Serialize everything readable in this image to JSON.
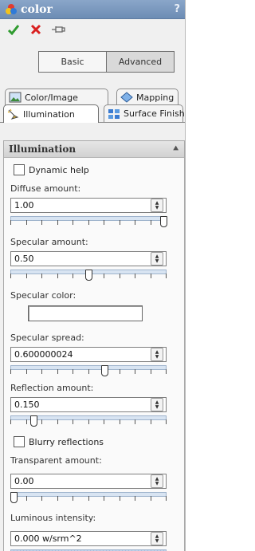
{
  "title": "color",
  "actions": {
    "ok_icon": "checkmark-icon",
    "cancel_icon": "x-icon",
    "pin_icon": "pushpin-icon"
  },
  "modes": [
    {
      "label": "Basic",
      "active": false
    },
    {
      "label": "Advanced",
      "active": true
    }
  ],
  "tabs": {
    "color_image": "Color/Image",
    "mapping": "Mapping",
    "illumination": "Illumination",
    "surface_finish": "Surface Finish"
  },
  "section": {
    "title": "Illumination",
    "dynamic_help": "Dynamic help",
    "diffuse": {
      "label": "Diffuse amount:",
      "value": "1.00",
      "level": 1.0
    },
    "specular": {
      "label": "Specular amount:",
      "value": "0.50",
      "level": 0.5
    },
    "specular_color": {
      "label": "Specular color:",
      "color": "#ffffff"
    },
    "spread": {
      "label": "Specular spread:",
      "value": "0.600000024",
      "level": 0.6
    },
    "reflection": {
      "label": "Reflection amount:",
      "value": "0.150",
      "level": 0.15
    },
    "blurry": "Blurry reflections",
    "transparent": {
      "label": "Transparent amount:",
      "value": "0.00",
      "level": 0.0
    },
    "luminous": {
      "label": "Luminous intensity:",
      "value": "0.000 w/srm^2"
    }
  }
}
